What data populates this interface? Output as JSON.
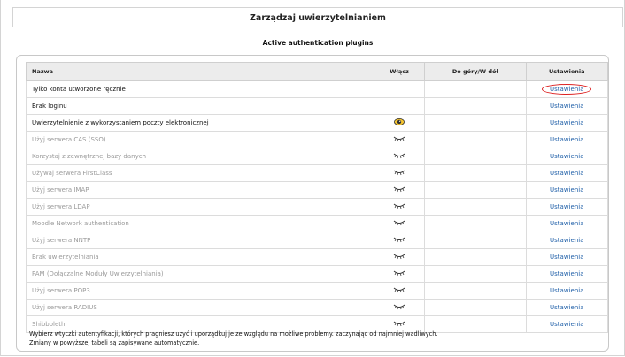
{
  "page": {
    "title": "Zarządzaj uwierzytelnianiem",
    "heading": "Active authentication plugins"
  },
  "table": {
    "columns": {
      "name": "Nazwa",
      "enable": "Włącz",
      "order": "Do góry/W dół",
      "settings": "Ustawienia"
    },
    "rows": [
      {
        "name": "Tylko konta utworzone ręcznie",
        "state": "none",
        "settings": "Ustawienia"
      },
      {
        "name": "Brak loginu",
        "state": "none",
        "settings": "Ustawienia"
      },
      {
        "name": "Uwierzytelnienie z wykorzystaniem poczty elektronicznej",
        "state": "enabled",
        "settings": "Ustawienia"
      },
      {
        "name": "Użyj serwera CAS (SSO)",
        "state": "disabled",
        "settings": "Ustawienia"
      },
      {
        "name": "Korzystaj z zewnętrznej bazy danych",
        "state": "disabled",
        "settings": "Ustawienia"
      },
      {
        "name": "Używaj serwera FirstClass",
        "state": "disabled",
        "settings": "Ustawienia"
      },
      {
        "name": "Użyj serwera IMAP",
        "state": "disabled",
        "settings": "Ustawienia"
      },
      {
        "name": "Użyj serwera LDAP",
        "state": "disabled",
        "settings": "Ustawienia"
      },
      {
        "name": "Moodle Network authentication",
        "state": "disabled",
        "settings": "Ustawienia"
      },
      {
        "name": "Użyj serwera NNTP",
        "state": "disabled",
        "settings": "Ustawienia"
      },
      {
        "name": "Brak uwierzytelniania",
        "state": "disabled",
        "settings": "Ustawienia"
      },
      {
        "name": "PAM (Dołączalne Moduły Uwierzytelniania)",
        "state": "disabled",
        "settings": "Ustawienia"
      },
      {
        "name": "Użyj serwera POP3",
        "state": "disabled",
        "settings": "Ustawienia"
      },
      {
        "name": "Użyj serwera RADIUS",
        "state": "disabled",
        "settings": "Ustawienia"
      },
      {
        "name": "Shibboleth",
        "state": "disabled",
        "settings": "Ustawienia"
      }
    ]
  },
  "footer": {
    "line1": "Wybierz wtyczki autentyfikacji, których pragniesz użyć i uporządkuj je ze względu na możliwe problemy. zaczynając od najmniej wadliwych.",
    "line2": "Zmiany w powyższej tabeli są zapisywane automatycznie."
  },
  "colors": {
    "link": "#1f5fa8",
    "highlight_circle": "#dd2222",
    "inactive_text": "#9a9a9a"
  },
  "icons": {
    "enabled": "eye-open-icon",
    "disabled": "eye-closed-icon"
  }
}
